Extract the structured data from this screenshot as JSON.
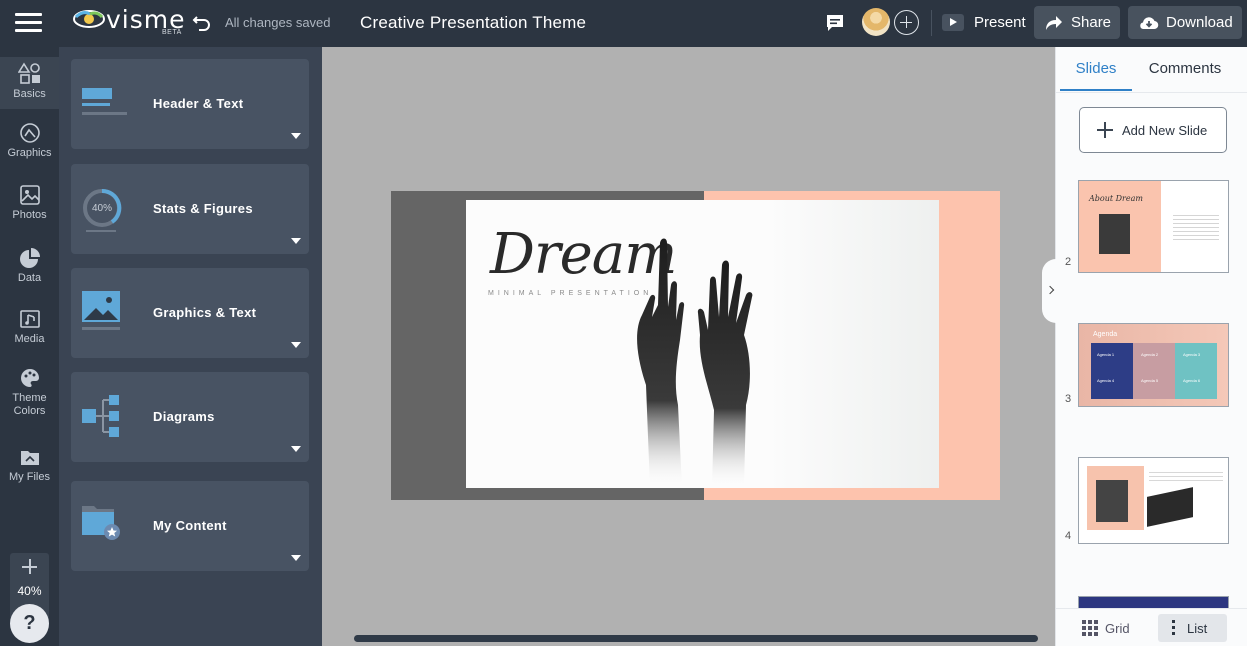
{
  "header": {
    "logo_text": "visme",
    "logo_beta": "BETA",
    "save_status": "All changes saved",
    "title": "Creative Presentation Theme",
    "present_label": "Present",
    "share_label": "Share",
    "download_label": "Download"
  },
  "rail": {
    "items": [
      {
        "label": "Basics",
        "icon": "shapes-icon"
      },
      {
        "label": "Graphics",
        "icon": "graphics-icon"
      },
      {
        "label": "Photos",
        "icon": "photo-icon"
      },
      {
        "label": "Data",
        "icon": "pie-chart-icon"
      },
      {
        "label": "Media",
        "icon": "media-icon"
      },
      {
        "label": "Theme",
        "label2": "Colors",
        "icon": "palette-icon"
      },
      {
        "label": "My Files",
        "icon": "folder-icon"
      }
    ],
    "zoom": "40%",
    "help": "?"
  },
  "panel": {
    "cards": [
      {
        "label": "Header & Text",
        "icon": "header-text-icon"
      },
      {
        "label": "Stats & Figures",
        "icon": "stats-icon",
        "stat_value": "40%"
      },
      {
        "label": "Graphics & Text",
        "icon": "image-text-icon"
      },
      {
        "label": "Diagrams",
        "icon": "diagram-icon"
      },
      {
        "label": "My Content",
        "icon": "folder-star-icon"
      }
    ]
  },
  "slide": {
    "title": "Dream",
    "subtitle": "MINIMAL PRESENTATION"
  },
  "right_panel": {
    "tabs": [
      "Slides",
      "Comments"
    ],
    "add_slide_label": "Add New Slide",
    "thumbnails": [
      {
        "number": "2",
        "heading": "About Dream"
      },
      {
        "number": "3",
        "heading": "Agenda",
        "items": [
          "Agenda 1",
          "Agenda 2",
          "Agenda 3",
          "Agenda 4",
          "Agenda 5",
          "Agenda 6"
        ]
      },
      {
        "number": "4"
      }
    ],
    "view_grid_label": "Grid",
    "view_list_label": "List"
  },
  "colors": {
    "topbar": "#2c3541",
    "panel": "#3a4453",
    "card": "#485363",
    "accent_blue": "#2f80c7",
    "peach": "#fdc3ad",
    "icon_blue": "#5fa8d8"
  }
}
